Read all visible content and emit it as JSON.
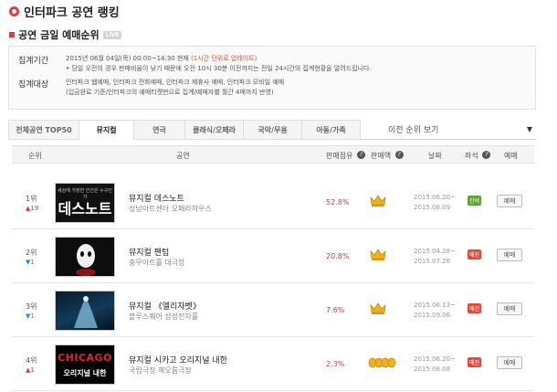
{
  "header": {
    "title": "인터파크 공연 랭킹"
  },
  "section": {
    "title": "공연 금일 예매순위",
    "badge": "LIVE"
  },
  "info": {
    "period_label": "집계기간",
    "period_line1": "2015년 06월 04일(목) 00:00~14:30 현재",
    "period_link": "(1시간 단위로 업데이트)",
    "period_note": "• 당일 오전의 경우 판매비율이 낮기 때문에 오전 10시 30분 이전까지는 전일 24시간의 집계현황을 알려드립니다.",
    "target_label": "집계대상",
    "target_line1": "인터파크 웹예매, 인터파크 전화예매, 인터파크 제휴사 예매, 인터파크 모바일 예매",
    "target_line2": "(입금완료 기준/인터파크의 예매티켓만으로 집계/예매자별 월간 4매까지 반영)"
  },
  "tabs": [
    "전체공연 TOP50",
    "뮤지컬",
    "연극",
    "클래식/오페라",
    "국악/무용",
    "아동/가족"
  ],
  "select": {
    "label": "이전 순위 보기",
    "arrow": "▼"
  },
  "columns": {
    "rank": "순위",
    "show": "공연",
    "share": "판매점유",
    "grade": "판매액",
    "date": "날짜",
    "seat": "좌석",
    "reserve": "예매"
  },
  "rows": [
    {
      "rank": "1위",
      "change": "▲19",
      "poster_text": "데스노트",
      "poster_sub": "세상에 가장한 인간은 누구인가",
      "name": "뮤지컬 데스노트",
      "venue": "성남아트센터 오페라하우스",
      "share": "52.8%",
      "date_start": "2015.06.20~",
      "date_end": "2015.08.09",
      "seat": "잔여",
      "reserve": "예매"
    },
    {
      "rank": "2위",
      "change": "▼1",
      "poster_text": "",
      "poster_sub": "",
      "name": "뮤지컬 팬텀",
      "venue": "충무아트홀 대극장",
      "share": "20.8%",
      "date_start": "2015.04.28~",
      "date_end": "2015.07.26",
      "seat": "매진",
      "reserve": "예매"
    },
    {
      "rank": "3위",
      "change": "▼1",
      "poster_text": "",
      "poster_sub": "",
      "name": "뮤지컬 《엘리자벳》",
      "venue": "블루스퀘어 삼성전자홀",
      "share": "7.6%",
      "date_start": "2015.06.13~",
      "date_end": "2015.09.06",
      "seat": "매진",
      "reserve": "예매"
    },
    {
      "rank": "4위",
      "change": "▲1",
      "poster_text": "CHICAGO",
      "poster_sub": "오리지널 내한",
      "name": "뮤지컬 시카고 오리지널 내한",
      "venue": "국립극장 해오름극장",
      "share": "2.3%",
      "date_start": "2015.06.20~",
      "date_end": "2015.08.08",
      "seat": "매진",
      "reserve": "예매"
    }
  ],
  "colors": {
    "accent": "#e03c3c",
    "link": "#d0543d",
    "seat_available": "#5aa62e",
    "seat_soldout": "#e24a3b",
    "rank_up": "#e03c3c",
    "rank_down": "#3a7fd3"
  }
}
